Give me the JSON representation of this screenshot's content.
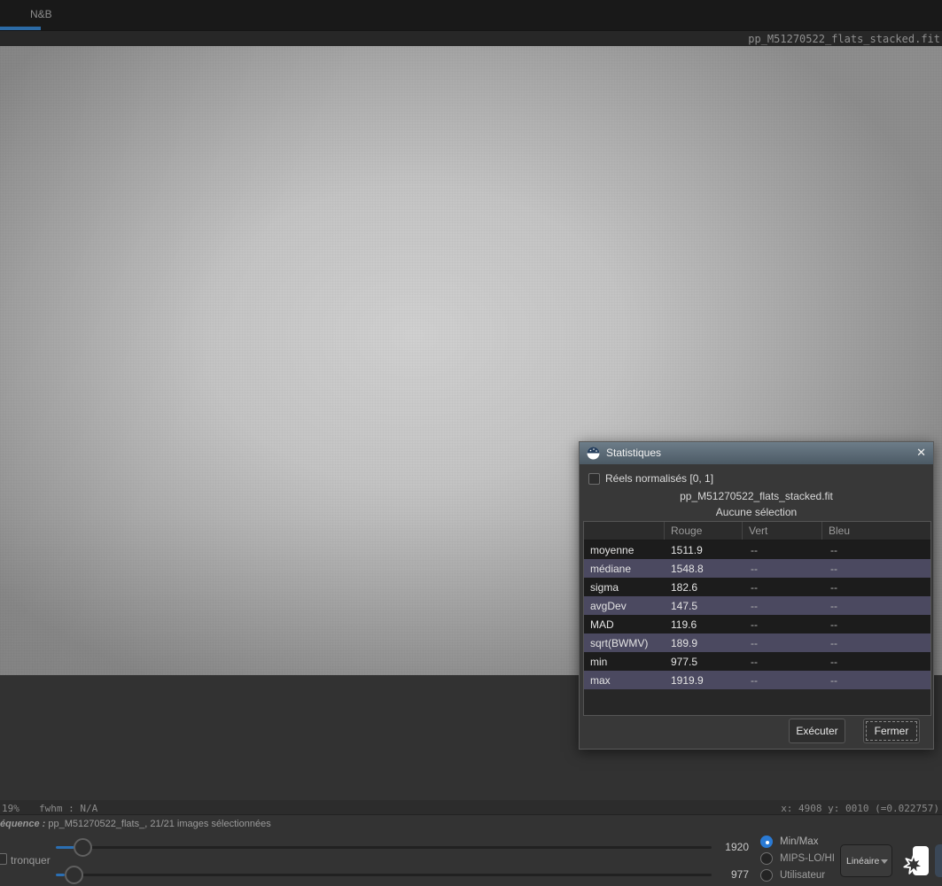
{
  "window": {
    "tab_label": "N&B",
    "image_filename": "pp_M51270522_flats_stacked.fit"
  },
  "statusbar": {
    "zoom_level": "19%",
    "fwhm": "fwhm : N/A",
    "coords": "x: 4908 y: 0010 (=0.022757)"
  },
  "sequence": {
    "label": "équence :",
    "value": "pp_M51270522_flats_, 21/21 images sélectionnées"
  },
  "controls": {
    "truncate_label": "tronquer",
    "hi_value": "1920",
    "lo_value": "977",
    "radios": [
      {
        "label": "Min/Max",
        "selected": true
      },
      {
        "label": "MIPS-LO/HI",
        "selected": false
      },
      {
        "label": "Utilisateur",
        "selected": false
      }
    ],
    "scale_mode": "Linéaire"
  },
  "dialog": {
    "title": "Statistiques",
    "close": "✕",
    "checkbox_label": "Réels normalisés [0, 1]",
    "filename": "pp_M51270522_flats_stacked.fit",
    "selection": "Aucune sélection",
    "table": {
      "columns": {
        "c0": "",
        "c1": "Rouge",
        "c2": "Vert",
        "c3": "Bleu"
      },
      "rows": [
        {
          "label": "moyenne",
          "rouge": "1511.9",
          "vert": "--",
          "bleu": "--"
        },
        {
          "label": "médiane",
          "rouge": "1548.8",
          "vert": "--",
          "bleu": "--"
        },
        {
          "label": "sigma",
          "rouge": "182.6",
          "vert": "--",
          "bleu": "--"
        },
        {
          "label": "avgDev",
          "rouge": "147.5",
          "vert": "--",
          "bleu": "--"
        },
        {
          "label": "MAD",
          "rouge": "119.6",
          "vert": "--",
          "bleu": "--"
        },
        {
          "label": "sqrt(BWMV)",
          "rouge": "189.9",
          "vert": "--",
          "bleu": "--"
        },
        {
          "label": "min",
          "rouge": "977.5",
          "vert": "--",
          "bleu": "--"
        },
        {
          "label": "max",
          "rouge": "1919.9",
          "vert": "--",
          "bleu": "--"
        }
      ]
    },
    "buttons": {
      "execute": "Exécuter",
      "close": "Fermer"
    }
  },
  "colors": {
    "accent_blue": "#2c6ba6",
    "selected_row_purple": "#4b4960",
    "titlebar_top": "#6d7d89",
    "titlebar_bottom": "#4c5a65"
  }
}
